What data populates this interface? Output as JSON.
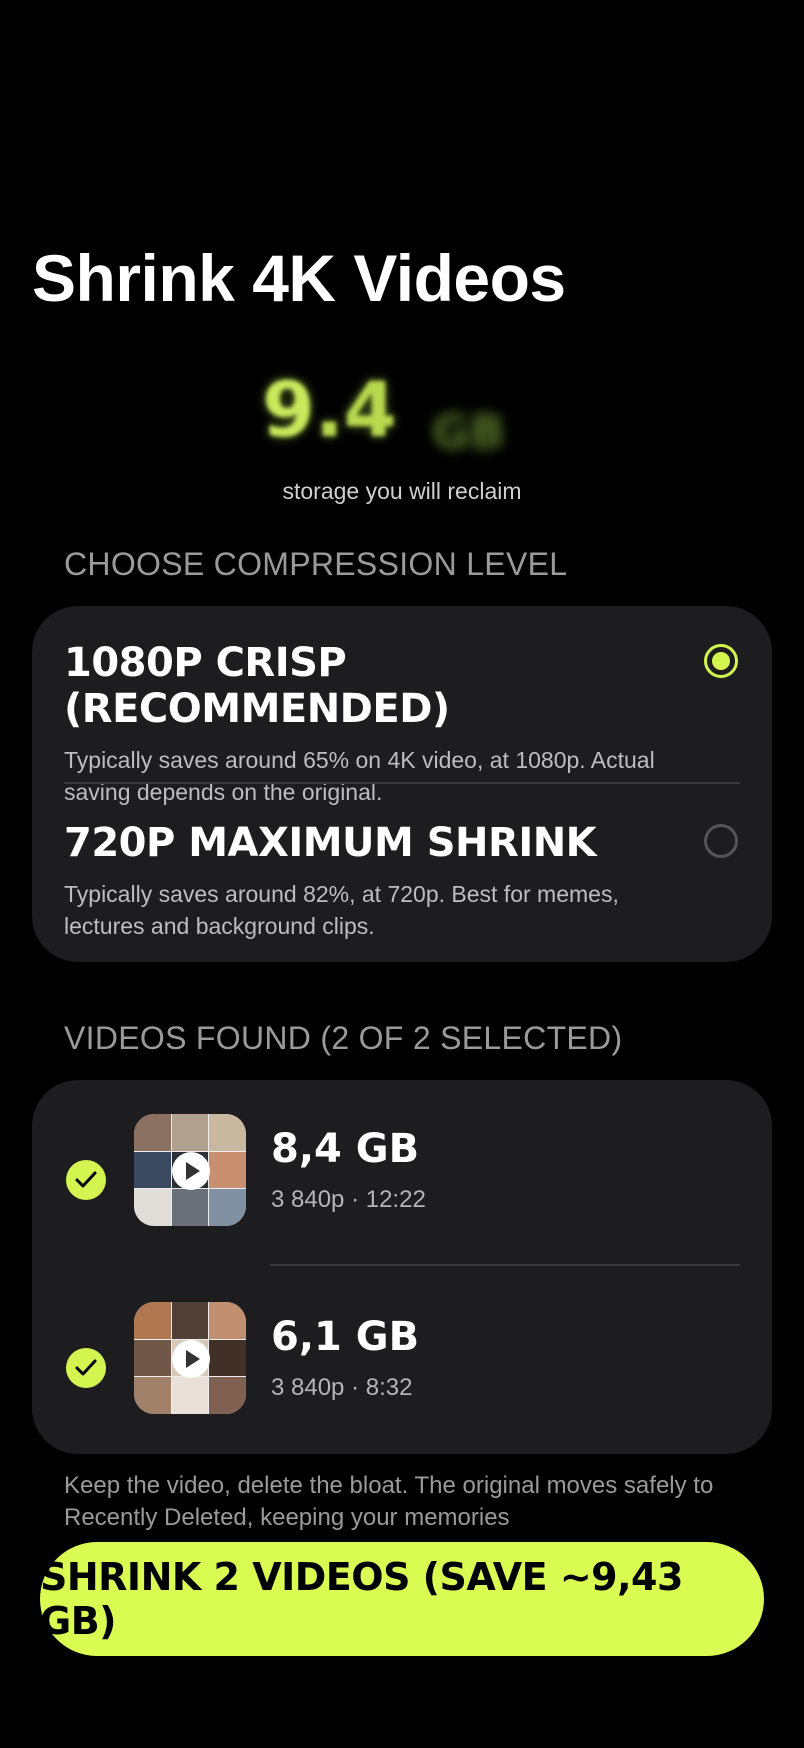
{
  "header": {
    "title": "Shrink 4K Videos"
  },
  "reclaim": {
    "value_int": "9",
    "value_dec": ".4",
    "unit": "GB",
    "subtitle": "storage you will reclaim"
  },
  "compression": {
    "section_label": "CHOOSE COMPRESSION LEVEL",
    "options": [
      {
        "title": "1080P CRISP (RECOMMENDED)",
        "description": "Typically saves around 65% on 4K video, at 1080p. Actual saving depends on the original.",
        "selected": true
      },
      {
        "title": "720P MAXIMUM SHRINK",
        "description": "Typically saves around 82%, at 720p. Best for memes, lectures and background clips.",
        "selected": false
      }
    ]
  },
  "videos": {
    "section_label": "VIDEOS FOUND (2 OF 2 SELECTED)",
    "items": [
      {
        "size": "8,4 GB",
        "meta": "3 840p · 12:22",
        "selected": true
      },
      {
        "size": "6,1 GB",
        "meta": "3 840p · 8:32",
        "selected": true
      }
    ]
  },
  "footer_note": "Keep the video, delete the bloat. The original moves safely to Recently Deleted, keeping your memories",
  "cta": {
    "label": "SHRINK 2 VIDEOS (SAVE ~9,43 GB)"
  },
  "colors": {
    "accent": "#d9fb52",
    "card_bg": "#1d1d1f",
    "background": "#000000"
  }
}
